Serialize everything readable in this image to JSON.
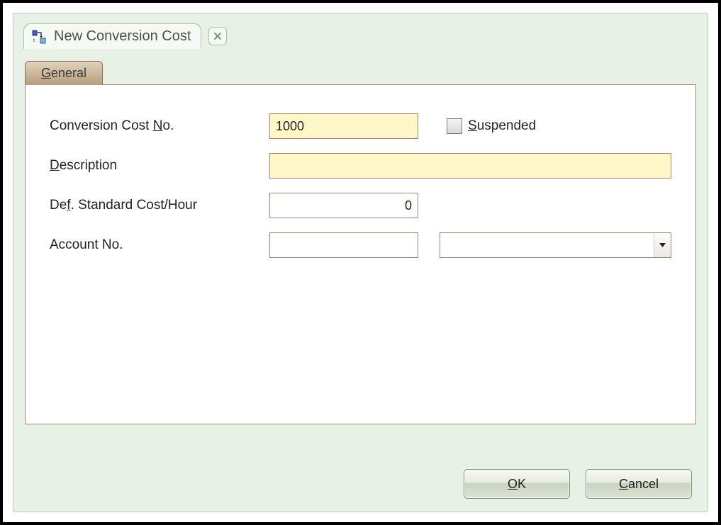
{
  "window": {
    "title": "New Conversion Cost"
  },
  "tabs": {
    "general": {
      "prefix": "",
      "accel": "G",
      "rest": "eneral"
    }
  },
  "form": {
    "cost_no": {
      "label_prefix": "Conversion Cost ",
      "label_accel": "N",
      "label_rest": "o.",
      "value": "1000"
    },
    "suspended": {
      "label_accel": "S",
      "label_rest": "uspended",
      "checked": false
    },
    "description": {
      "label_accel": "D",
      "label_rest": "escription",
      "value": ""
    },
    "std_cost": {
      "label_prefix": "De",
      "label_accel": "f",
      "label_rest": ". Standard Cost/Hour",
      "value": "0"
    },
    "account_no": {
      "label": "Account No.",
      "value": "",
      "combo_value": ""
    }
  },
  "buttons": {
    "ok": {
      "accel": "O",
      "rest": "K"
    },
    "cancel": {
      "accel": "C",
      "rest": "ancel"
    }
  }
}
